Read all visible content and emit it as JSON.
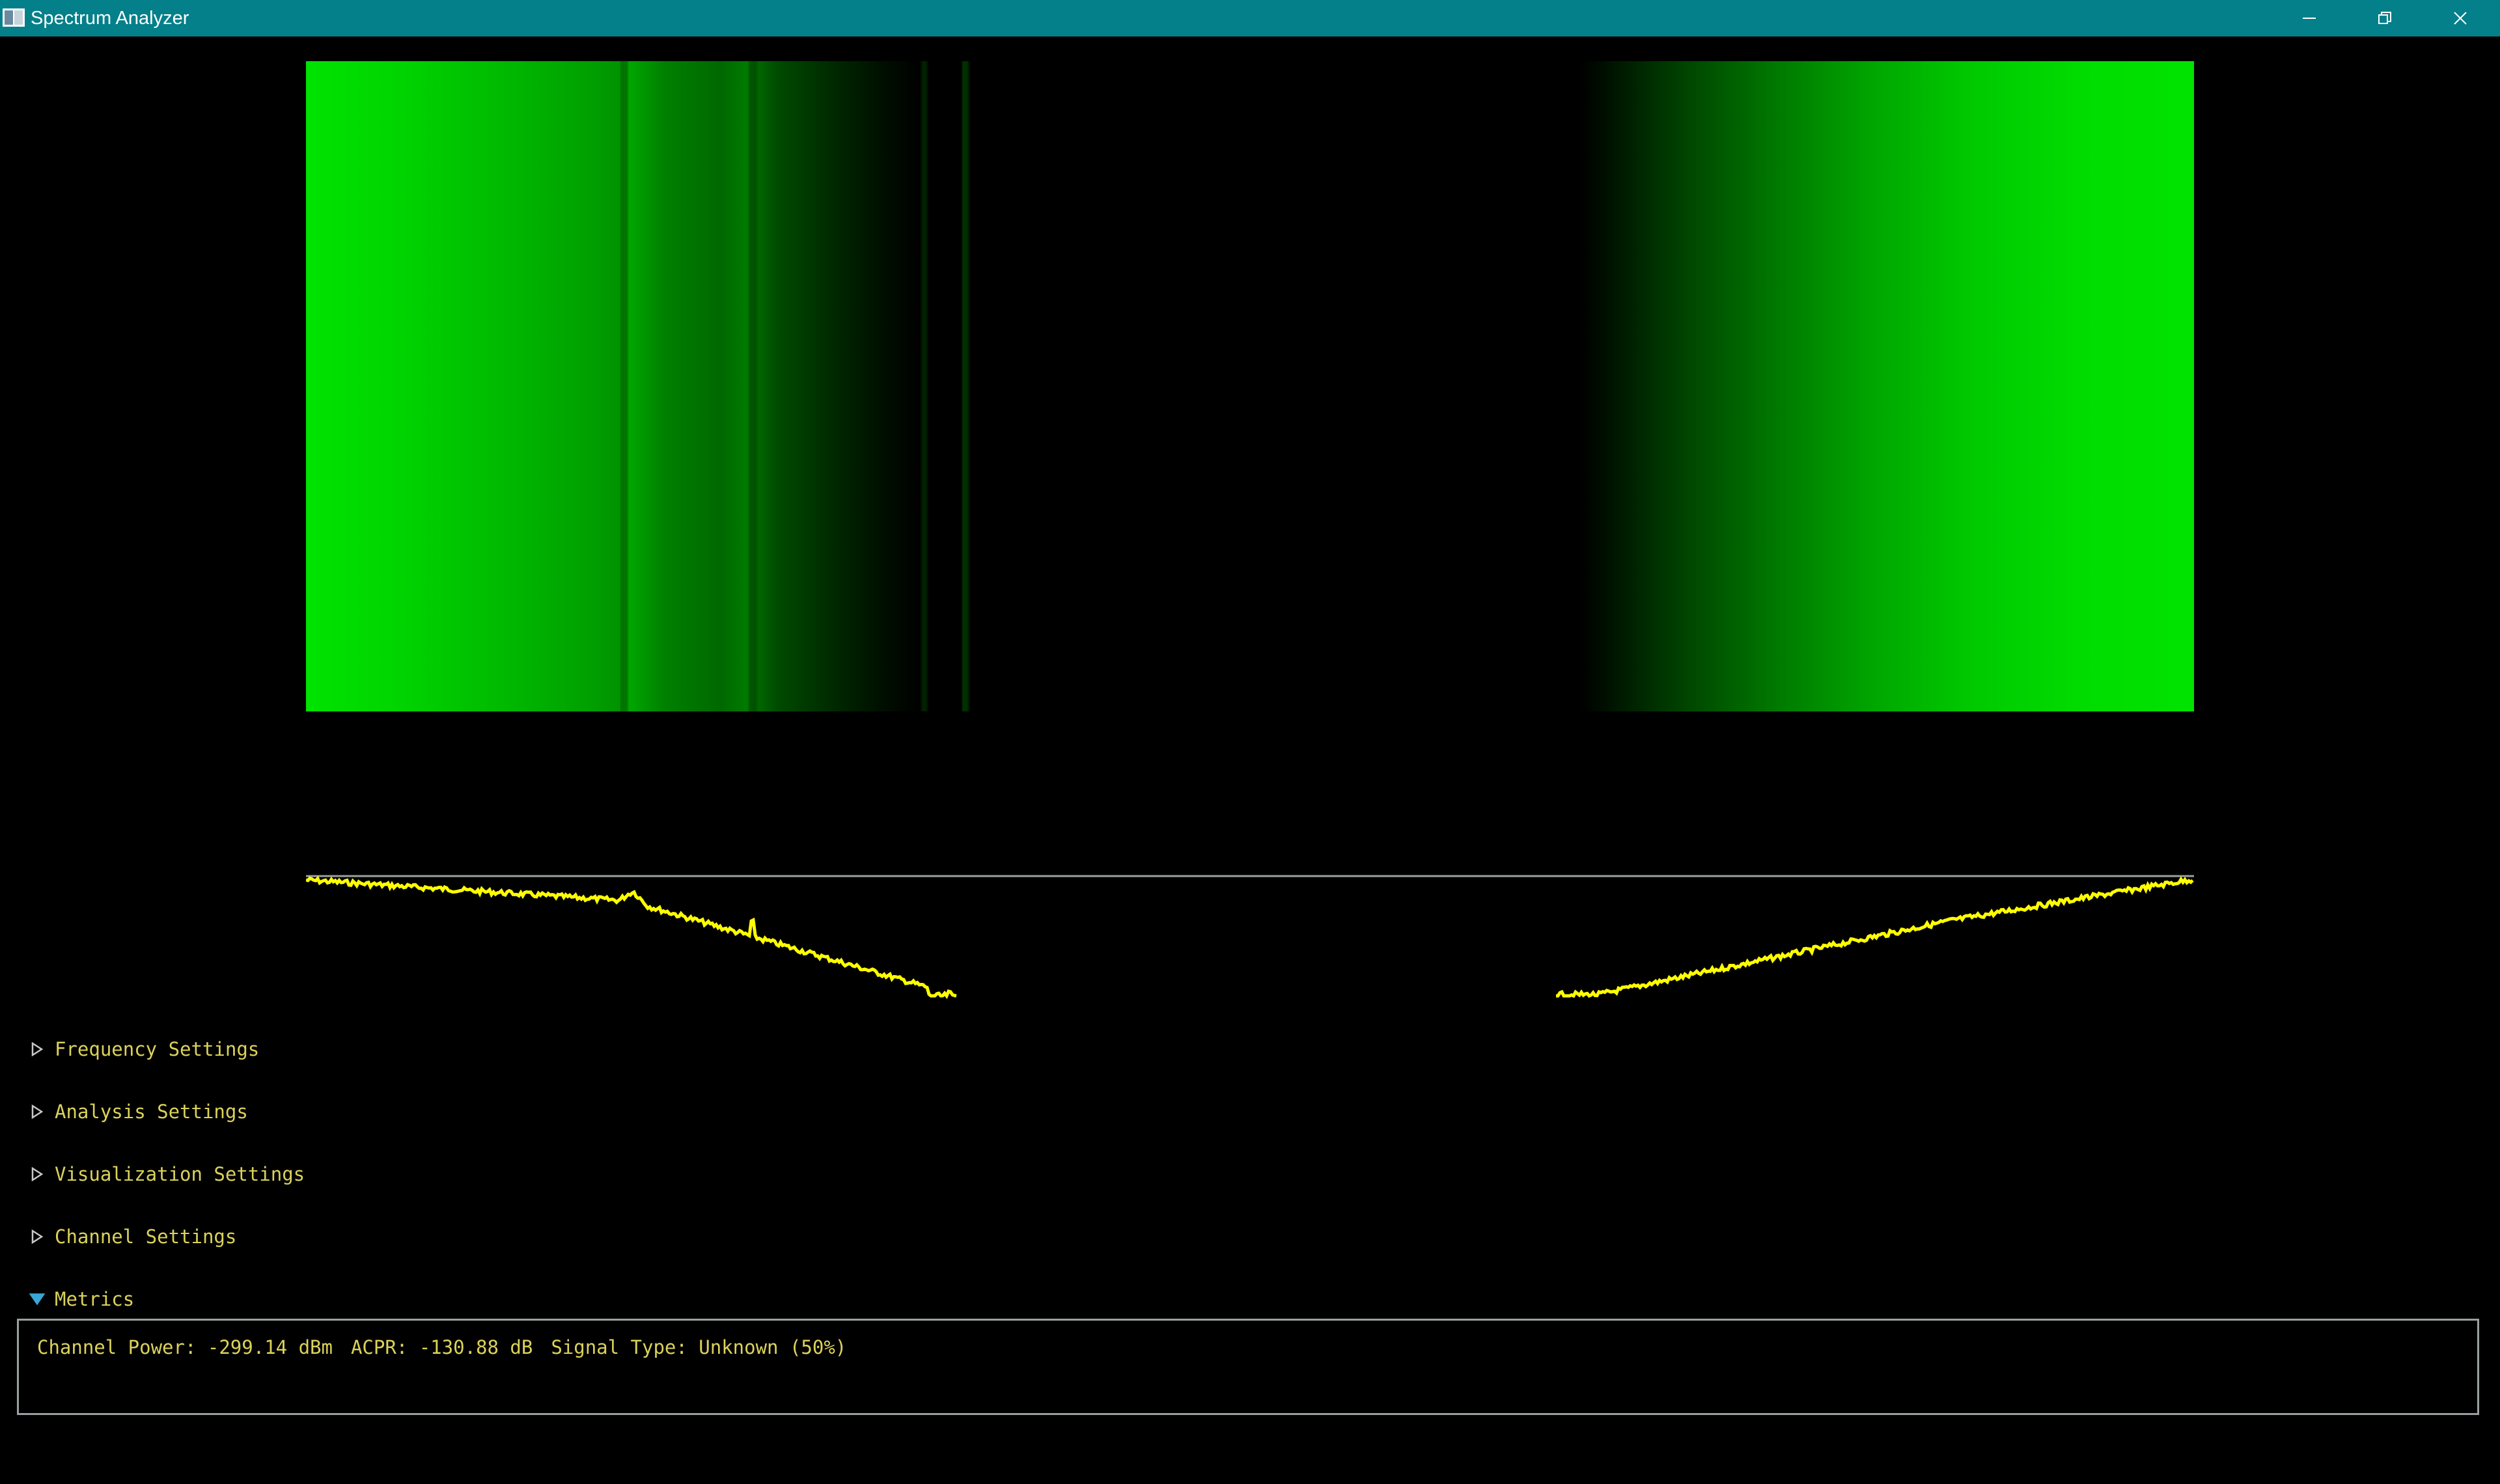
{
  "window": {
    "title": "Spectrum Analyzer",
    "titlebar_color": "#03808a",
    "buttons": [
      "minimize-icon",
      "restore-icon",
      "close-icon"
    ]
  },
  "colors": {
    "background": "#000000",
    "waterfall_peak": "#00e300",
    "trace": "#ffff00",
    "reference_line": "#9aa0a2",
    "ui_text": "#dbd25a",
    "expanded_arrow": "#3aa6d6"
  },
  "panels": [
    {
      "label": "Frequency Settings",
      "expanded": false
    },
    {
      "label": "Analysis Settings",
      "expanded": false
    },
    {
      "label": "Visualization Settings",
      "expanded": false
    },
    {
      "label": "Channel Settings",
      "expanded": false
    },
    {
      "label": "Metrics",
      "expanded": true
    }
  ],
  "metrics": {
    "channel_power": "Channel Power: -299.14 dBm",
    "acpr": "ACPR: -130.88 dB",
    "signal_type": "Signal Type: Unknown (50%)"
  }
}
